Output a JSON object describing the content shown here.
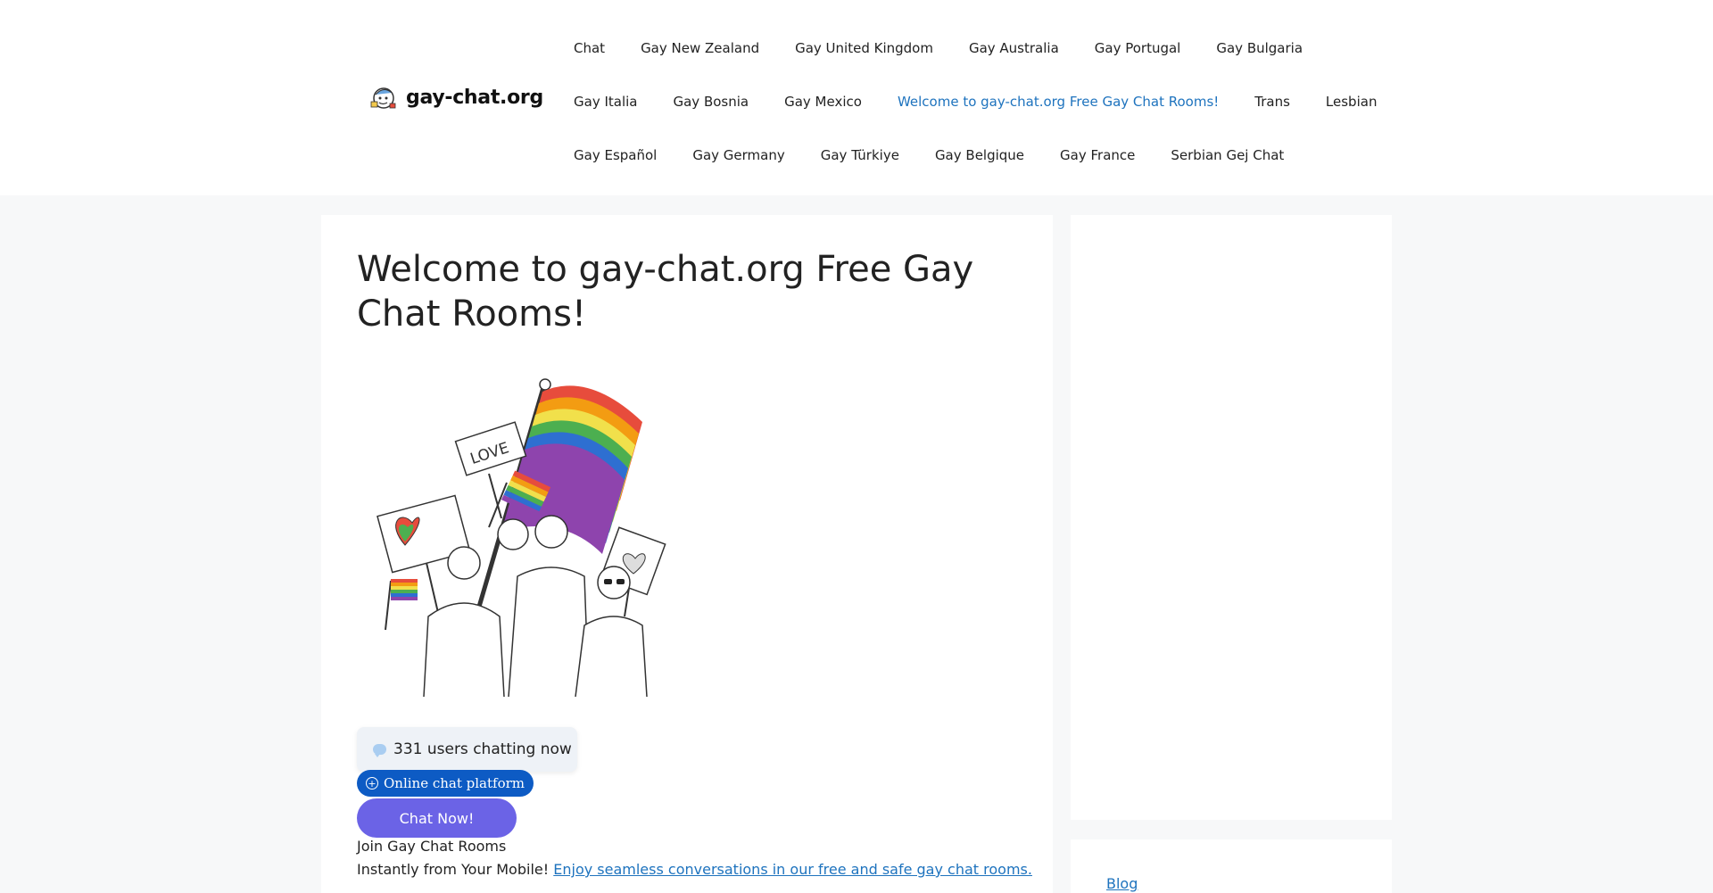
{
  "site": {
    "logo_text": "gay-chat.org"
  },
  "nav": {
    "rows": [
      [
        "Chat",
        "Gay New Zealand",
        "Gay United Kingdom",
        "Gay Australia",
        "Gay Portugal",
        "Gay Bulgaria"
      ],
      [
        "Gay Italia",
        "Gay Bosnia",
        "Gay Mexico",
        "Welcome to gay-chat.org Free Gay Chat Rooms!",
        "Trans",
        "Lesbian"
      ],
      [
        "Gay Español",
        "Gay Germany",
        "Gay Türkiye",
        "Gay Belgique",
        "Gay France",
        "Serbian Gej Chat"
      ]
    ],
    "active": "Welcome to gay-chat.org Free Gay Chat Rooms!"
  },
  "main": {
    "title": "Welcome to gay-chat.org Free Gay Chat Rooms!",
    "hero_sign_text": "LOVE",
    "users_count_text": "331 users chatting now",
    "platform_badge": "Online chat platform",
    "cta_label": "Chat Now!",
    "join_text": "Join Gay Chat Rooms",
    "instant_text": "Instantly from Your Mobile!",
    "instant_link": "Enjoy seamless conversations in our free and safe gay chat rooms."
  },
  "sidebar": {
    "blog_link": "Blog"
  },
  "colors": {
    "accent_link": "#1e73be",
    "cta": "#6b63e6",
    "badge": "#0d5bc4"
  }
}
